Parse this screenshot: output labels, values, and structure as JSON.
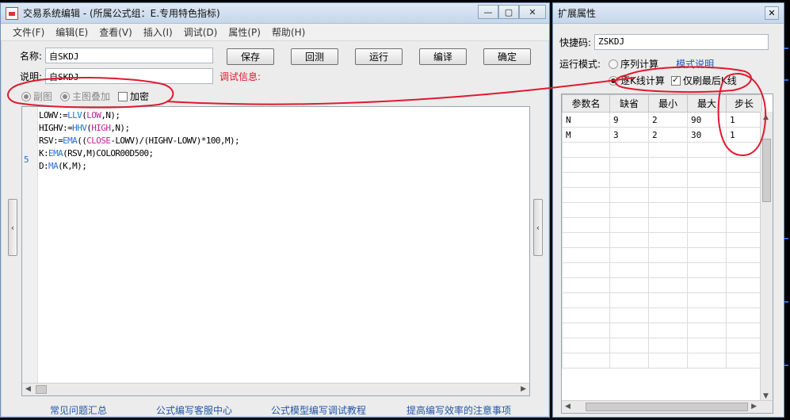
{
  "editor_window": {
    "title": "交易系统编辑 - (所属公式组：E.专用特色指标)",
    "controls": {
      "minimize": "—",
      "maximize": "▢",
      "close": "✕"
    }
  },
  "menu": [
    "文件(F)",
    "编辑(E)",
    "查看(V)",
    "插入(I)",
    "调试(D)",
    "属性(P)",
    "帮助(H)"
  ],
  "form": {
    "name_label": "名称:",
    "name_value": "自SKDJ",
    "desc_label": "说明:",
    "desc_value": "自SKDJ",
    "debug_info": "调试信息:"
  },
  "buttons": {
    "save": "保存",
    "backtest": "回测",
    "run": "运行",
    "compile": "编译",
    "ok": "确定"
  },
  "options": {
    "sub_chart": "副图",
    "main_overlay": "主图叠加",
    "encrypt": "加密"
  },
  "code": {
    "lines": [
      [
        "LOWV:=",
        "LLV",
        "(",
        "LOW",
        ",N);"
      ],
      [
        "HIGHV:=",
        "HHV",
        "(",
        "HIGH",
        ",N);"
      ],
      [
        "RSV:=",
        "EMA",
        "((",
        "CLOSE",
        "-LOWV)/(HIGHV-LOWV)*100,M);"
      ],
      [
        "K:",
        "EMA",
        "(RSV,M)COLOR00D500;",
        "",
        ""
      ],
      [
        "D:",
        "MA",
        "(K,M);",
        "",
        ""
      ]
    ],
    "line_number": "5"
  },
  "footer_links": [
    "常见问题汇总",
    "公式编写客服中心",
    "公式模型编写调试教程",
    "提高编写效率的注意事项"
  ],
  "prop_window": {
    "title": "扩展属性",
    "close": "✕",
    "shortcut_label": "快捷码:",
    "shortcut_value": "ZSKDJ",
    "run_mode_label": "运行模式:",
    "seq_calc": "序列计算",
    "mode_help": "模式说明",
    "per_k_calc": "逐K线计算",
    "refresh_last": "仅刷最后K线"
  },
  "param_table": {
    "headers": [
      "参数名",
      "缺省",
      "最小",
      "最大",
      "步长"
    ],
    "rows": [
      [
        "N",
        "9",
        "2",
        "90",
        "1"
      ],
      [
        "M",
        "3",
        "2",
        "30",
        "1"
      ]
    ]
  },
  "colors": {
    "annotation": "#e0192e",
    "accent_link": "#2456a8",
    "func": "#2a6fd6",
    "var": "#c1249a"
  }
}
